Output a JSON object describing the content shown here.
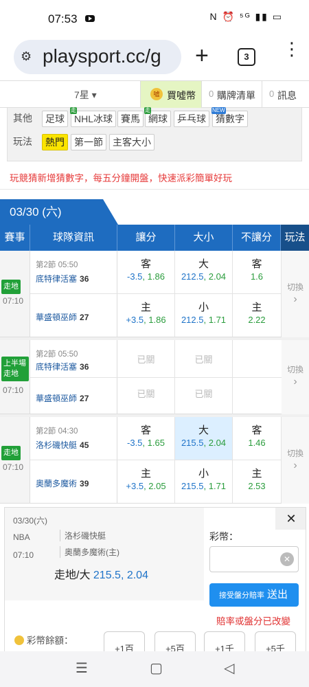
{
  "status": {
    "time": "07:53",
    "icons": "N ⏰ ⁵ᴳ ▮▮ ▭"
  },
  "browser": {
    "url": "playsport.cc/g",
    "tab_count": "3"
  },
  "topnav": {
    "star": "7星 ▾",
    "buy": "買噓幣",
    "buy_coin": "噓",
    "cart_count": "0",
    "cart": "購牌清單",
    "msg_count": "0",
    "msg": "訊息"
  },
  "filters": {
    "other_label": "其他",
    "other": [
      {
        "label": "足球"
      },
      {
        "label": "NHL冰球",
        "badge": "走"
      },
      {
        "label": "賽馬"
      },
      {
        "label": "網球",
        "badge": "走"
      },
      {
        "label": "乒乓球"
      },
      {
        "label": "猜數字",
        "badge": "NEW"
      }
    ],
    "play_label": "玩法",
    "play": [
      {
        "label": "熱門",
        "active": true
      },
      {
        "label": "第一節"
      },
      {
        "label": "主客大小"
      }
    ]
  },
  "promo": "玩競猜新增猜數字，每五分鐘開盤，快速派彩簡單好玩",
  "date": "03/30 (六)",
  "headers": [
    "賽事",
    "球隊資訊",
    "讓分",
    "大小",
    "不讓分",
    "玩法"
  ],
  "games": [
    {
      "tag": "走地",
      "time": "07:10",
      "period": "第2節 05:50",
      "away": {
        "name": "底特律活塞",
        "score": "36",
        "spread_side": "客",
        "spread": "-3.5",
        "spread_odds": "1.86",
        "ou_side": "大",
        "ou": "212.5",
        "ou_odds": "2.04",
        "ml_side": "客",
        "ml_odds": "1.6"
      },
      "home": {
        "name": "華盛頓巫師",
        "score": "27",
        "spread_side": "主",
        "spread": "+3.5",
        "spread_odds": "1.86",
        "ou_side": "小",
        "ou": "212.5",
        "ou_odds": "1.71",
        "ml_side": "主",
        "ml_odds": "2.22"
      },
      "switch": "切換"
    },
    {
      "tag": "上半場 走地",
      "time": "07:10",
      "period": "第2節 05:50",
      "away": {
        "name": "底特律活塞",
        "score": "36"
      },
      "home": {
        "name": "華盛頓巫師",
        "score": "27"
      },
      "closed": "已關",
      "switch": "切換"
    },
    {
      "tag": "走地",
      "time": "07:10",
      "period": "第2節 04:30",
      "away": {
        "name": "洛杉磯快艇",
        "score": "45",
        "spread_side": "客",
        "spread": "-3.5",
        "spread_odds": "1.65",
        "ou_side": "大",
        "ou": "215.5",
        "ou_odds": "2.04",
        "ml_side": "客",
        "ml_odds": "1.46"
      },
      "home": {
        "name": "奧蘭多魔術",
        "score": "39",
        "spread_side": "主",
        "spread": "+3.5",
        "spread_odds": "2.05",
        "ou_side": "小",
        "ou": "215.5",
        "ou_odds": "1.71",
        "ml_side": "主",
        "ml_odds": "2.53"
      },
      "switch": "切換"
    }
  ],
  "betslip": {
    "date": "03/30(六)",
    "league": "NBA",
    "time": "07:10",
    "away": "洛杉磯快艇",
    "home": "奧蘭多魔術(主)",
    "pick_label": "走地/大",
    "pick_line": "215.5, 2.04",
    "stake_label": "彩幣：",
    "send_small": "接受盤分賠率",
    "send": "送出",
    "warning": "賠率或盤分已改變",
    "balance_label": "彩幣餘額：",
    "quick": [
      "+1百",
      "+5百",
      "+1千",
      "+5千"
    ]
  },
  "navbar": {
    "menu": "☰",
    "home": "▢",
    "back": "◁"
  }
}
